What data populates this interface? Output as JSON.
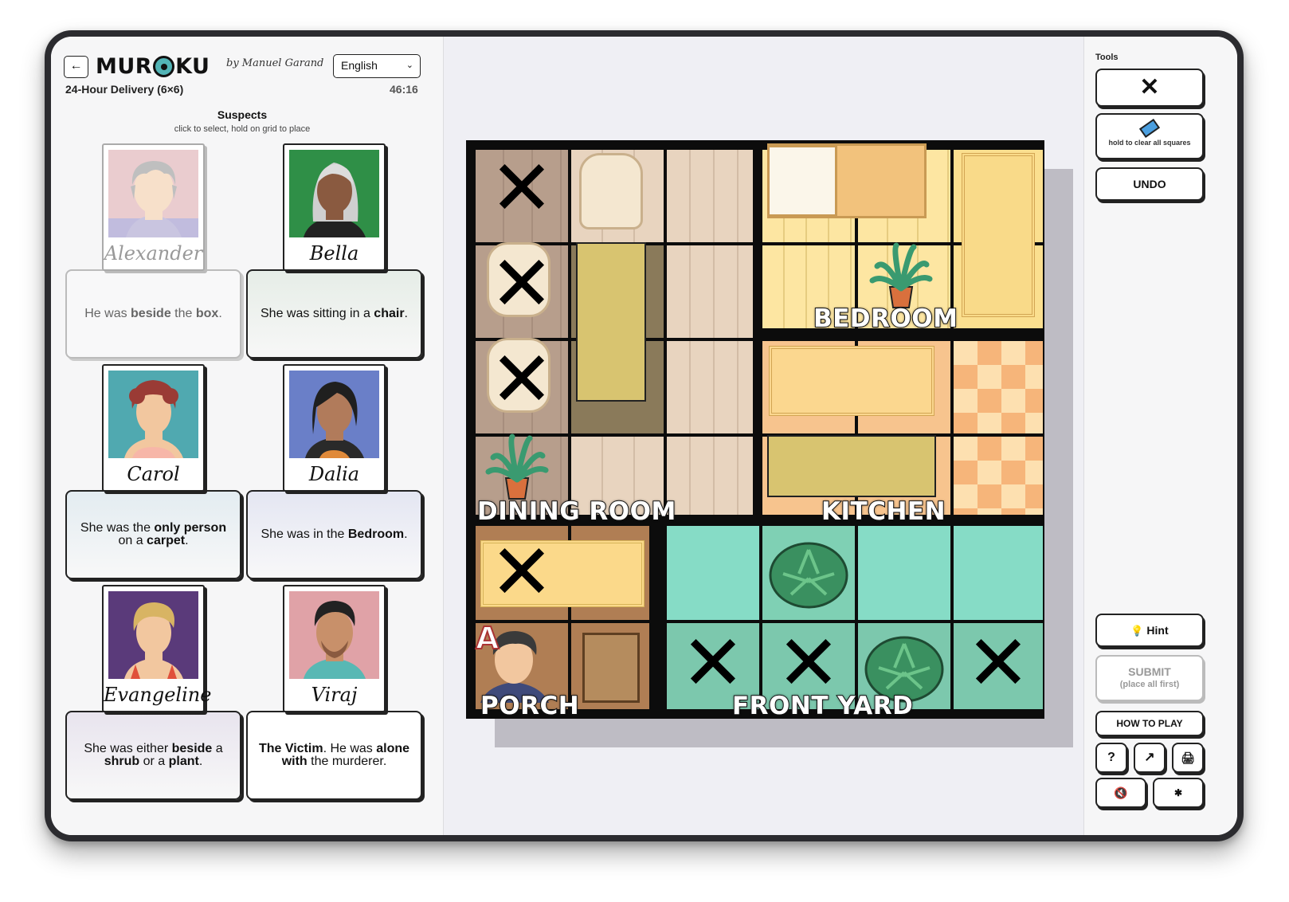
{
  "header": {
    "back_icon": "←",
    "logo_left": "MUR",
    "logo_right": "KU",
    "byline": "by Manuel Garand",
    "language": "English",
    "puzzle_title": "24-Hour Delivery (6×6)",
    "timer": "46:16"
  },
  "suspects_panel": {
    "heading": "Suspects",
    "subheading": "click to select, hold on grid to place"
  },
  "suspects": [
    {
      "name": "Alexander",
      "clue_parts": [
        [
          "He was ",
          false
        ],
        [
          "beside",
          true
        ],
        [
          " the ",
          false
        ],
        [
          "box",
          true
        ],
        [
          ".",
          false
        ]
      ],
      "placed": true
    },
    {
      "name": "Bella",
      "clue_parts": [
        [
          "She was sitting in a ",
          false
        ],
        [
          "chair",
          true
        ],
        [
          ".",
          false
        ]
      ],
      "placed": false
    },
    {
      "name": "Carol",
      "clue_parts": [
        [
          "She was the ",
          false
        ],
        [
          "only person",
          true
        ],
        [
          " on a ",
          false
        ],
        [
          "carpet",
          true
        ],
        [
          ".",
          false
        ]
      ],
      "placed": false
    },
    {
      "name": "Dalia",
      "clue_parts": [
        [
          "She was in the ",
          false
        ],
        [
          "Bedroom",
          true
        ],
        [
          ".",
          false
        ]
      ],
      "placed": false
    },
    {
      "name": "Evangeline",
      "clue_parts": [
        [
          "She was either ",
          false
        ],
        [
          "beside",
          true
        ],
        [
          " a ",
          false
        ],
        [
          "shrub",
          true
        ],
        [
          " or a ",
          false
        ],
        [
          "plant",
          true
        ],
        [
          ".",
          false
        ]
      ],
      "placed": false
    },
    {
      "name": "Viraj",
      "clue_parts": [
        [
          "The Victim",
          true
        ],
        [
          ". He was ",
          false
        ],
        [
          "alone with",
          true
        ],
        [
          " the murderer.",
          false
        ]
      ],
      "placed": false
    }
  ],
  "board": {
    "rooms": [
      "DINING ROOM",
      "BEDROOM",
      "KITCHEN",
      "PORCH",
      "FRONT YARD"
    ],
    "x_glyph": "✕",
    "placed_marker": "A"
  },
  "tools": {
    "heading": "Tools",
    "x_tool_icon": "✕",
    "eraser_icon": "eraser-icon",
    "eraser_label": "hold to clear all squares",
    "undo": "UNDO",
    "hint_icon": "💡",
    "hint": "Hint",
    "submit": "SUBMIT",
    "submit_sub": "(place all first)",
    "how_to_play": "HOW TO PLAY",
    "help_icon": "?",
    "share_icon": "↗",
    "print_icon": "🖨",
    "mute_icon": "🔇",
    "settings_icon": "✱"
  },
  "colors": {
    "wood": "#d9c2ab",
    "bedroom": "#fbe49a",
    "kitchen_tile": "#f7c48e",
    "grass": "#7fdcc2",
    "porch": "#b07e54"
  }
}
